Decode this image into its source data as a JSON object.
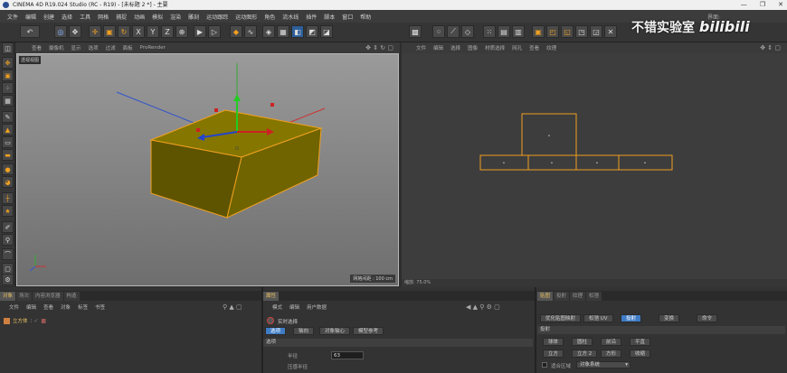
{
  "window": {
    "title": "CINEMA 4D R19.024 Studio (RC - R19) - [未标题 2 *] - 主要",
    "controls": [
      "—",
      "❐",
      "✕"
    ]
  },
  "menu": {
    "items": [
      "文件",
      "编辑",
      "创建",
      "选择",
      "工具",
      "网格",
      "捕捉",
      "动画",
      "模拟",
      "渲染",
      "雕刻",
      "运动跟踪",
      "运动图形",
      "角色",
      "流水线",
      "插件",
      "脚本",
      "窗口",
      "帮助"
    ],
    "layout_label": "界面:"
  },
  "watermark": {
    "text": "不错实验室",
    "brand": "bilibili"
  },
  "viewport": {
    "menu": [
      "查看",
      "摄像机",
      "显示",
      "选项",
      "过滤",
      "面板",
      "ProRender"
    ],
    "label": "透视视图",
    "grid_label": "网格间距 : 100 cm",
    "colors": {
      "box_fill": "#8a7a00",
      "box_edge": "#f0a020",
      "bg_top": "#9a9a9a",
      "bg_bottom": "#6e6e6e"
    }
  },
  "uv_panel": {
    "menu": [
      "文件",
      "编辑",
      "选择",
      "图像",
      "材质选择",
      "网孔",
      "查看",
      "纹理"
    ],
    "status": "缩放: 75.0%"
  },
  "objects_panel": {
    "tabs": [
      "对象",
      "场次",
      "内容浏览器",
      "构造"
    ],
    "active_tab": 0,
    "menu": [
      "文件",
      "编辑",
      "查看",
      "对象",
      "标签",
      "书签"
    ],
    "object_name": "立方体"
  },
  "attributes_panel": {
    "tabs": [
      "属性"
    ],
    "menu": [
      "模式",
      "编辑",
      "用户数据"
    ],
    "mode_label": "实时选择",
    "subtabs": [
      "选项",
      "轴向",
      "对象轴心",
      "模型参考"
    ],
    "active_subtab": 0,
    "section": "选项",
    "fields": [
      {
        "label": "半径",
        "value": "63"
      },
      {
        "label": "压感半径",
        "value": ""
      }
    ]
  },
  "uv_tools_panel": {
    "tabs": [
      "贴图",
      "投射",
      "纹理",
      "松弛"
    ],
    "active_tab": 0,
    "row1": [
      "优化贴图映射",
      "松弛 UV",
      "投射",
      "变换",
      "命令"
    ],
    "active_row1": 2,
    "section": "投射",
    "buttons_row1": [
      "球体",
      "圆柱",
      "前沿",
      "平直"
    ],
    "buttons_row2": [
      "立方",
      "立方 2",
      "方形",
      "收缩"
    ],
    "option_label": "适合区域",
    "option_value": "对象系统"
  }
}
